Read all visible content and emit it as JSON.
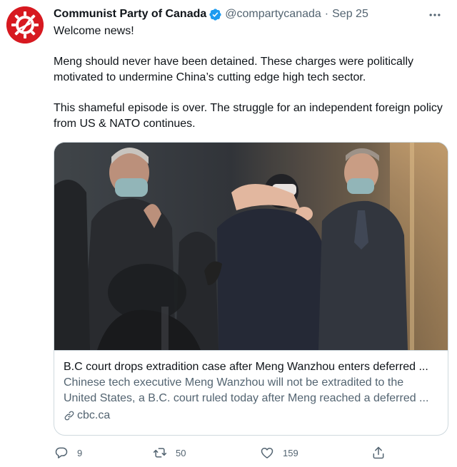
{
  "account": {
    "name": "Communist Party of Canada",
    "handle": "@compartycanada",
    "separator": "·",
    "date": "Sep 25",
    "verified": true,
    "avatar_color": "#d71920"
  },
  "tweet": {
    "paragraphs": [
      "Welcome news!",
      "Meng should never have been detained. These charges were politically motivated to undermine China’s cutting edge high tech sector.",
      "This shameful episode is over. The struggle for an independent foreign policy from US & NATO continues."
    ]
  },
  "card": {
    "title": "B.C court drops extradition case after Meng Wanzhou enters deferred ...",
    "description_lines": [
      "Chinese tech executive Meng Wanzhou will not be extradited to the",
      "United States, a B.C. court ruled today after Meng reached a deferred ..."
    ],
    "domain": "cbc.ca",
    "link_icon": "link-icon"
  },
  "actions": {
    "reply": {
      "icon": "reply-icon",
      "count": "9"
    },
    "retweet": {
      "icon": "retweet-icon",
      "count": "50"
    },
    "like": {
      "icon": "heart-icon",
      "count": "159"
    },
    "share": {
      "icon": "share-icon"
    }
  },
  "colors": {
    "text": "#0f1419",
    "secondary": "#536471",
    "verified": "#1d9bf0",
    "border": "#cfd9de"
  }
}
